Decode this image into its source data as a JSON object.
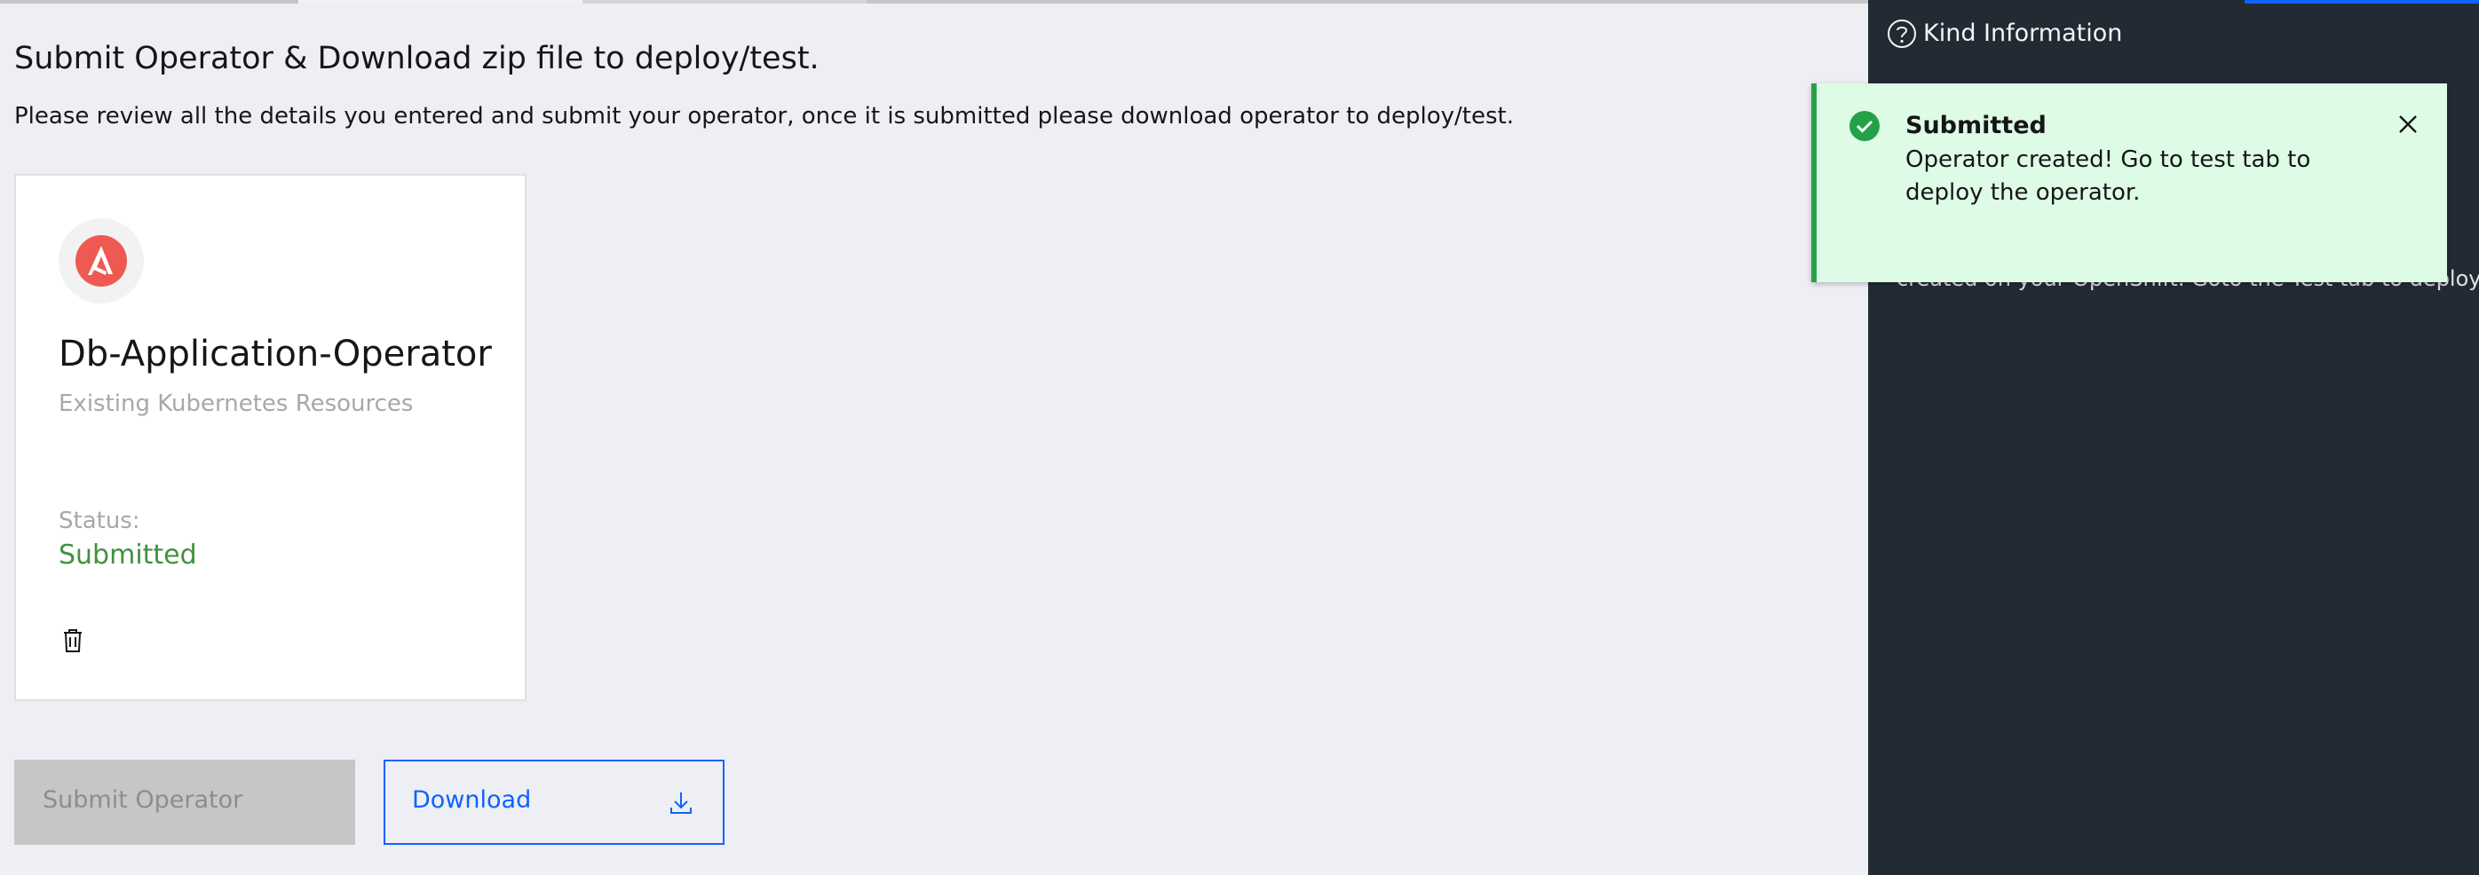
{
  "main": {
    "title": "Submit Operator & Download zip file to deploy/test.",
    "description": "Please review all the details you entered and submit your operator, once it is submitted please download operator to deploy/test."
  },
  "card": {
    "logo_icon": "ansible-logo-icon",
    "name": "Db-Application-Operator",
    "type": "Existing Kubernetes Resources",
    "status_label": "Status:",
    "status_value": "Submitted",
    "delete_icon": "trash-icon"
  },
  "actions": {
    "submit_label": "Submit Operator",
    "download_label": "Download",
    "download_icon": "download-icon"
  },
  "side_panel": {
    "help_icon": "question-circle-icon",
    "title": "Kind Information",
    "partial_text": "created on your OpenShift. Goto the Test tab to deploy."
  },
  "notification": {
    "status_icon": "checkmark-filled-icon",
    "title": "Submitted",
    "message": "Operator created! Go to test tab to deploy the operator.",
    "close_icon": "close-icon"
  },
  "colors": {
    "accent": "#0f62fe",
    "success": "#24a148",
    "status_text": "#42913f",
    "side_background": "#222b34",
    "toast_background": "#defbe6"
  }
}
